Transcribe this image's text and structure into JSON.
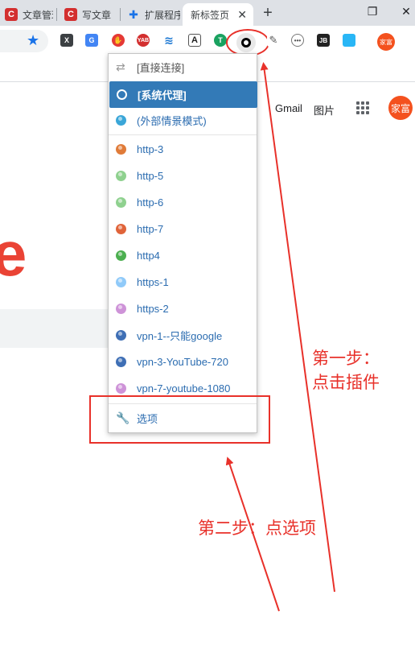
{
  "tabs": [
    {
      "title": "文章管理",
      "favicon": "C"
    },
    {
      "title": "写文章",
      "favicon": "C"
    },
    {
      "title": "扩展程序",
      "favicon": "puzzle-icon"
    },
    {
      "title": "新标签页",
      "active": true
    }
  ],
  "toolbar": {
    "extensions": [
      "x-icon",
      "translate-icon",
      "adblock-icon",
      "yab-icon",
      "layers-icon",
      "font-icon",
      "t-icon",
      "proxy-switch-icon",
      "eyedropper-icon",
      "dots-icon",
      "jb-icon",
      "screenshot-icon"
    ],
    "avatar": "家富"
  },
  "page": {
    "gmail": "Gmail",
    "images": "图片",
    "avatar": "家富",
    "logo_letter": "e"
  },
  "menu": {
    "direct": "[直接连接]",
    "system": "[系统代理]",
    "external": "(外部情景模式)",
    "profiles": [
      {
        "label": "http-3",
        "color": "#e07b39"
      },
      {
        "label": "http-5",
        "color": "#8fd18f"
      },
      {
        "label": "http-6",
        "color": "#8fd18f"
      },
      {
        "label": "http-7",
        "color": "#e0643a"
      },
      {
        "label": "http4",
        "color": "#4caf50"
      },
      {
        "label": "https-1",
        "color": "#90caf9"
      },
      {
        "label": "https-2",
        "color": "#ce93d8"
      },
      {
        "label": "vpn-1--只能google",
        "color": "#3f6fb5"
      },
      {
        "label": "vpn-3-YouTube-720",
        "color": "#3f6fb5"
      },
      {
        "label": "vpn-7-youtube-1080",
        "color": "#ce93d8"
      }
    ],
    "options": "选项"
  },
  "annotations": {
    "step1_line1": "第一步：",
    "step1_line2": "点击插件",
    "step2": "第二步：点选项",
    "color": "#e8312a"
  }
}
